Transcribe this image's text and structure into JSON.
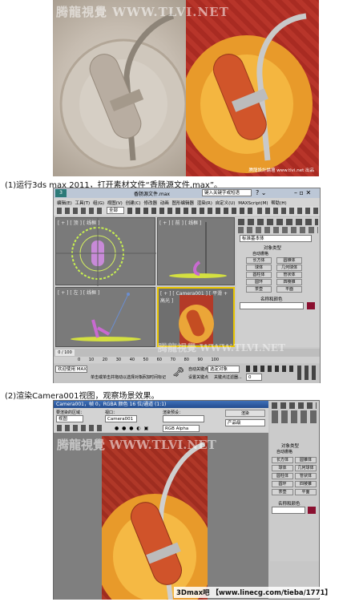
{
  "hero": {
    "watermark": "腾龍視覺 WWW.TLVI.NET",
    "footer": "腾龍設計論壇 www.tlvi.net 出品"
  },
  "captions": {
    "step1": "(1)运行3ds max 2011，打开素材文件“香肠源文件.max”。",
    "step2": "(2)渲染Camera001视图，观察场景效果。"
  },
  "max": {
    "window_title": "香肠源文件.max",
    "search_placeholder": "键入关键字或短语",
    "menus": [
      "编辑(E)",
      "工具(T)",
      "组(G)",
      "视图(V)",
      "创建(C)",
      "修改器",
      "动画",
      "图形编辑器",
      "渲染(R)",
      "自定义(U)",
      "MAXScript(M)",
      "帮助(H)"
    ],
    "selection_filter": "全部",
    "viewports": [
      {
        "label": "[ + ] [ 顶 ] [ 线框 ]"
      },
      {
        "label": "[ + ] [ 前 ] [ 线框 ]"
      },
      {
        "label": "[ + ] [ 左 ] [ 线框 ]"
      },
      {
        "label": "[ + ] [ Camera001 ] [ 平滑 + 高光 ]"
      }
    ],
    "panel": {
      "dropdown": "标准基本体",
      "rollout_object_type": "对象类型",
      "autogrid": "自动栅格",
      "buttons": [
        "长方体",
        "圆锥体",
        "球体",
        "几何球体",
        "圆柱体",
        "管状体",
        "圆环",
        "四棱锥",
        "茶壶",
        "平面"
      ],
      "rollout_name_color": "名称和颜色"
    },
    "timeline": {
      "position": "0 / 100",
      "ticks": [
        "0",
        "10",
        "20",
        "30",
        "40",
        "50",
        "60",
        "70",
        "80",
        "90",
        "100"
      ]
    },
    "status": {
      "welcome": "欢迎使用 MAXSc",
      "prompt": "单击或单击并拖动以选择对象",
      "add_time_tag": "添加时间标记",
      "auto_key": "自动关键点",
      "selected": "选定对象",
      "set_key": "设置关键点",
      "key_filters": "关键点过滤器...",
      "frame": "0"
    }
  },
  "render": {
    "title": "Camera001，帧 0，RGBA 颜色 16 位/通道 (1:1)",
    "area_label": "要渲染的区域：",
    "area_value": "视图",
    "viewport_label": "视口：",
    "viewport_value": "Camera001",
    "preset_label": "渲染预设：",
    "preset_value": "",
    "render_button": "渲染",
    "product_value": "产品级",
    "channel": "RGB Alpha",
    "watermark": "腾龍視覺 WWW.TLVI.NET",
    "panel_buttons": [
      "长方体",
      "圆锥体",
      "球体",
      "几何球体",
      "圆柱体",
      "管状体",
      "圆环",
      "四棱锥",
      "茶壶",
      "平面"
    ],
    "rollout_object_type": "对象类型",
    "autogrid": "自动栅格",
    "rollout_name_color": "名称和颜色"
  },
  "footer_badge": "3Dmax吧 【www.linecg.com/tieba/1771】",
  "colors": {
    "accent": "#2d5da8",
    "sausage": "#c8552c",
    "plate": "#f0a030",
    "bg_red": "#a92b22"
  }
}
